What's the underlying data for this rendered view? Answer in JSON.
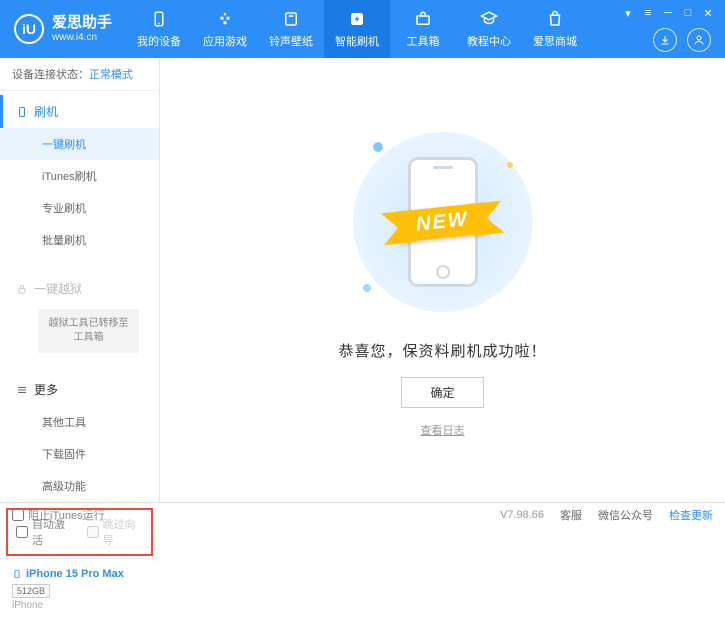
{
  "header": {
    "logo_letter": "iU",
    "title": "爱思助手",
    "url": "www.i4.cn",
    "nav": [
      {
        "label": "我的设备",
        "icon": "device"
      },
      {
        "label": "应用游戏",
        "icon": "apps"
      },
      {
        "label": "铃声壁纸",
        "icon": "ringtone"
      },
      {
        "label": "智能刷机",
        "icon": "flash"
      },
      {
        "label": "工具箱",
        "icon": "toolbox"
      },
      {
        "label": "教程中心",
        "icon": "tutorial"
      },
      {
        "label": "爱思商城",
        "icon": "store"
      }
    ]
  },
  "sidebar": {
    "status_label": "设备连接状态：",
    "status_value": "正常模式",
    "flash_head": "刷机",
    "flash_items": [
      "一键刷机",
      "iTunes刷机",
      "专业刷机",
      "批量刷机"
    ],
    "jailbreak_head": "一键越狱",
    "jailbreak_note": "越狱工具已转移至工具箱",
    "more_head": "更多",
    "more_items": [
      "其他工具",
      "下载固件",
      "高级功能"
    ],
    "auto_activate": "自动激活",
    "skip_guide": "跳过向导",
    "device_name": "iPhone 15 Pro Max",
    "device_storage": "512GB",
    "device_type": "iPhone"
  },
  "main": {
    "ribbon": "NEW",
    "success": "恭喜您，保资料刷机成功啦！",
    "ok": "确定",
    "log": "查看日志"
  },
  "footer": {
    "block_itunes": "阻止iTunes运行",
    "version": "V7.98.66",
    "links": [
      "客服",
      "微信公众号",
      "检查更新"
    ]
  }
}
